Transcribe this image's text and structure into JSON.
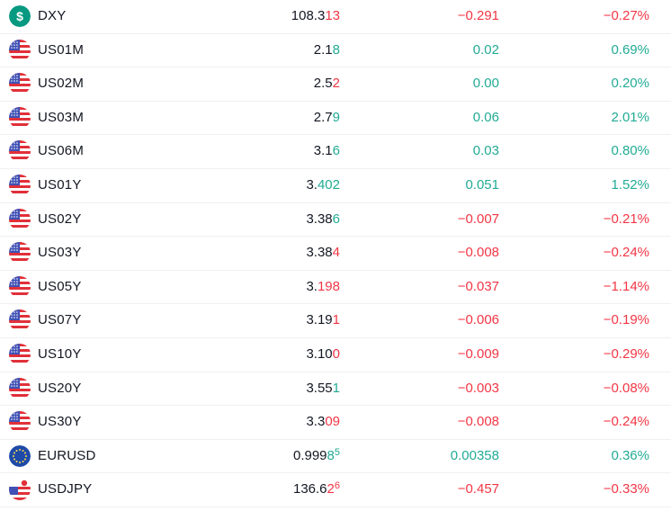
{
  "colors": {
    "up": "#22ab94",
    "down": "#f23645",
    "dxy_icon": "#089981",
    "text": "#131722"
  },
  "rows": [
    {
      "symbol": "DXY",
      "icon": "dollar-circle-icon",
      "last_main": "108.3",
      "last_tail": "13",
      "last_sup": "",
      "tail_dir": "down",
      "change": "−0.291",
      "change_pct": "−0.27%",
      "dir": "down"
    },
    {
      "symbol": "US01M",
      "icon": "us-flag-icon",
      "last_main": "2.1",
      "last_tail": "8",
      "last_sup": "",
      "tail_dir": "up",
      "change": "0.02",
      "change_pct": "0.69%",
      "dir": "up"
    },
    {
      "symbol": "US02M",
      "icon": "us-flag-icon",
      "last_main": "2.5",
      "last_tail": "2",
      "last_sup": "",
      "tail_dir": "down",
      "change": "0.00",
      "change_pct": "0.20%",
      "dir": "up"
    },
    {
      "symbol": "US03M",
      "icon": "us-flag-icon",
      "last_main": "2.7",
      "last_tail": "9",
      "last_sup": "",
      "tail_dir": "up",
      "change": "0.06",
      "change_pct": "2.01%",
      "dir": "up"
    },
    {
      "symbol": "US06M",
      "icon": "us-flag-icon",
      "last_main": "3.1",
      "last_tail": "6",
      "last_sup": "",
      "tail_dir": "up",
      "change": "0.03",
      "change_pct": "0.80%",
      "dir": "up"
    },
    {
      "symbol": "US01Y",
      "icon": "us-flag-icon",
      "last_main": "3.",
      "last_tail": "402",
      "last_sup": "",
      "tail_dir": "up",
      "change": "0.051",
      "change_pct": "1.52%",
      "dir": "up"
    },
    {
      "symbol": "US02Y",
      "icon": "us-flag-icon",
      "last_main": "3.38",
      "last_tail": "6",
      "last_sup": "",
      "tail_dir": "up",
      "change": "−0.007",
      "change_pct": "−0.21%",
      "dir": "down"
    },
    {
      "symbol": "US03Y",
      "icon": "us-flag-icon",
      "last_main": "3.38",
      "last_tail": "4",
      "last_sup": "",
      "tail_dir": "down",
      "change": "−0.008",
      "change_pct": "−0.24%",
      "dir": "down"
    },
    {
      "symbol": "US05Y",
      "icon": "us-flag-icon",
      "last_main": "3.",
      "last_tail": "198",
      "last_sup": "",
      "tail_dir": "down",
      "change": "−0.037",
      "change_pct": "−1.14%",
      "dir": "down"
    },
    {
      "symbol": "US07Y",
      "icon": "us-flag-icon",
      "last_main": "3.19",
      "last_tail": "1",
      "last_sup": "",
      "tail_dir": "down",
      "change": "−0.006",
      "change_pct": "−0.19%",
      "dir": "down"
    },
    {
      "symbol": "US10Y",
      "icon": "us-flag-icon",
      "last_main": "3.10",
      "last_tail": "0",
      "last_sup": "",
      "tail_dir": "down",
      "change": "−0.009",
      "change_pct": "−0.29%",
      "dir": "down"
    },
    {
      "symbol": "US20Y",
      "icon": "us-flag-icon",
      "last_main": "3.55",
      "last_tail": "1",
      "last_sup": "",
      "tail_dir": "up",
      "change": "−0.003",
      "change_pct": "−0.08%",
      "dir": "down"
    },
    {
      "symbol": "US30Y",
      "icon": "us-flag-icon",
      "last_main": "3.3",
      "last_tail": "09",
      "last_sup": "",
      "tail_dir": "down",
      "change": "−0.008",
      "change_pct": "−0.24%",
      "dir": "down"
    },
    {
      "symbol": "EURUSD",
      "icon": "eu-flag-icon",
      "last_main": "0.999",
      "last_tail": "8",
      "last_sup": "5",
      "tail_dir": "up",
      "change": "0.00358",
      "change_pct": "0.36%",
      "dir": "up"
    },
    {
      "symbol": "USDJPY",
      "icon": "us-jp-flag-icon",
      "last_main": "136.6",
      "last_tail": "2",
      "last_sup": "6",
      "tail_dir": "down",
      "change": "−0.457",
      "change_pct": "−0.33%",
      "dir": "down"
    }
  ]
}
